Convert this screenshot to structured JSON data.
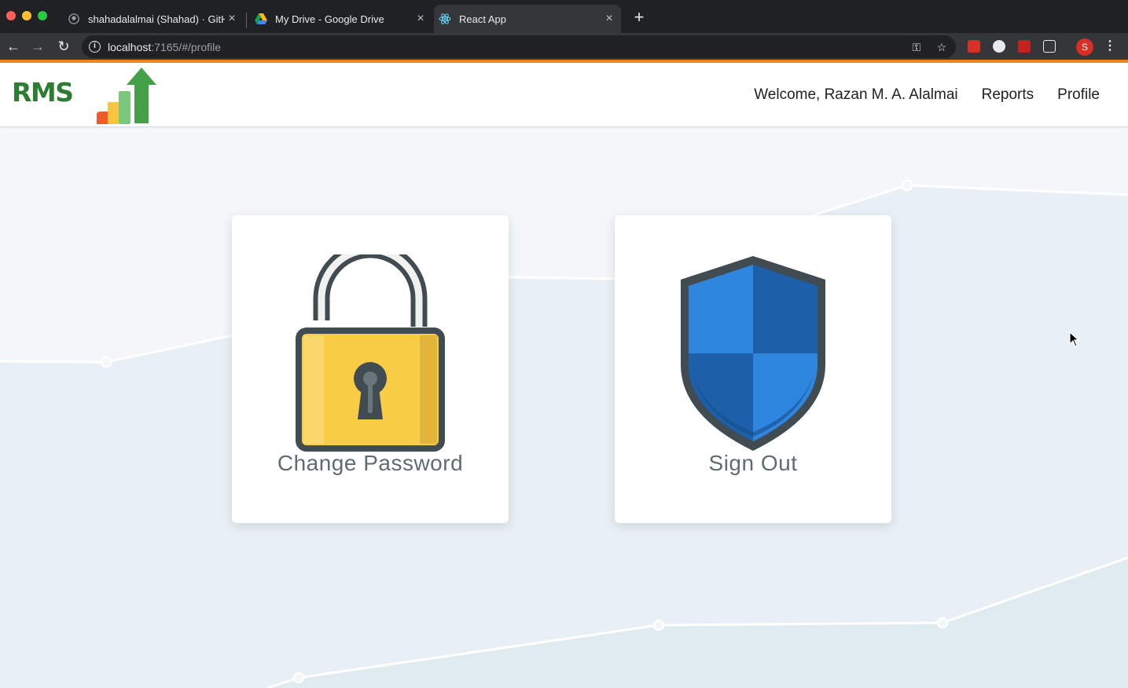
{
  "browser": {
    "tabs": [
      {
        "title": "shahadalalmai (Shahad) · GitH",
        "icon": "github-icon"
      },
      {
        "title": "My Drive - Google Drive",
        "icon": "google-drive-icon"
      },
      {
        "title": "React App",
        "icon": "react-icon",
        "active": true
      }
    ],
    "new_tab": "+",
    "url_host": "localhost",
    "url_path": ":7165/#/profile",
    "profile_initial": "S"
  },
  "app": {
    "logo_text": "RMS",
    "nav": {
      "welcome": "Welcome, Razan M. A. Alalmai",
      "reports": "Reports",
      "profile": "Profile"
    },
    "cards": [
      {
        "label": "Change Password",
        "icon": "padlock-icon"
      },
      {
        "label": "Sign Out",
        "icon": "shield-icon"
      }
    ]
  },
  "colors": {
    "accent_bar": "#e8871e",
    "logo_green": "#2e7d32",
    "lock_yellow": "#f9cc46",
    "shield_blue": "#2f86df",
    "label_gray": "#5f6c72"
  }
}
